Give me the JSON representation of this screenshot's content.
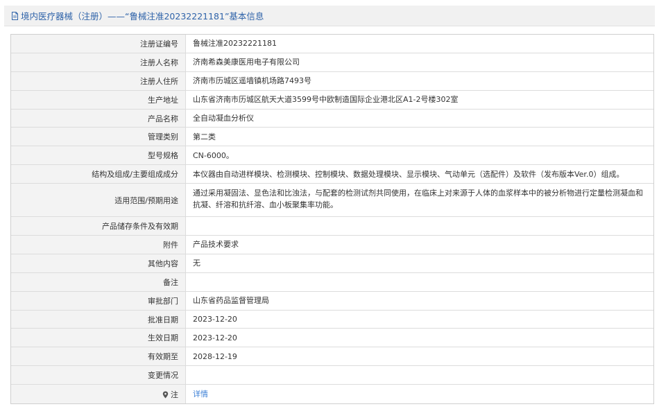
{
  "header": {
    "title": "境内医疗器械（注册）——“鲁械注准20232221181”基本信息"
  },
  "rows": [
    {
      "label": "注册证编号",
      "value": "鲁械注准20232221181"
    },
    {
      "label": "注册人名称",
      "value": "济南希森美康医用电子有限公司"
    },
    {
      "label": "注册人住所",
      "value": "济南市历城区遥墙镇机场路7493号"
    },
    {
      "label": "生产地址",
      "value": "山东省济南市历城区航天大道3599号中欧制造国际企业港北区A1-2号楼302室"
    },
    {
      "label": "产品名称",
      "value": "全自动凝血分析仪"
    },
    {
      "label": "管理类别",
      "value": "第二类"
    },
    {
      "label": "型号规格",
      "value": "CN-6000。"
    },
    {
      "label": "结构及组成/主要组成成分",
      "value": "本仪器由自动进样模块、检测模块、控制模块、数据处理模块、显示模块、气动单元（选配件）及软件（发布版本Ver.0）组成。"
    },
    {
      "label": "适用范围/预期用途",
      "value": "通过采用凝固法、显色法和比浊法，与配套的检测试剂共同使用，在临床上对来源于人体的血浆样本中的被分析物进行定量检测凝血和抗凝、纤溶和抗纤溶、血小板聚集率功能。"
    },
    {
      "label": "产品储存条件及有效期",
      "value": ""
    },
    {
      "label": "附件",
      "value": "产品技术要求"
    },
    {
      "label": "其他内容",
      "value": "无"
    },
    {
      "label": "备注",
      "value": ""
    },
    {
      "label": "审批部门",
      "value": "山东省药品监督管理局"
    },
    {
      "label": "批准日期",
      "value": "2023-12-20"
    },
    {
      "label": "生效日期",
      "value": "2023-12-20"
    },
    {
      "label": "有效期至",
      "value": "2028-12-19"
    },
    {
      "label": "变更情况",
      "value": ""
    },
    {
      "label": "注",
      "value": "详情"
    }
  ],
  "colors": {
    "title_text": "#2f63a9",
    "link": "#3b7fd6",
    "label_bg": "#f3f3f3",
    "border": "#dcdcdc"
  },
  "icons": {
    "title_icon": "document-icon",
    "note_icon": "pin-icon"
  }
}
